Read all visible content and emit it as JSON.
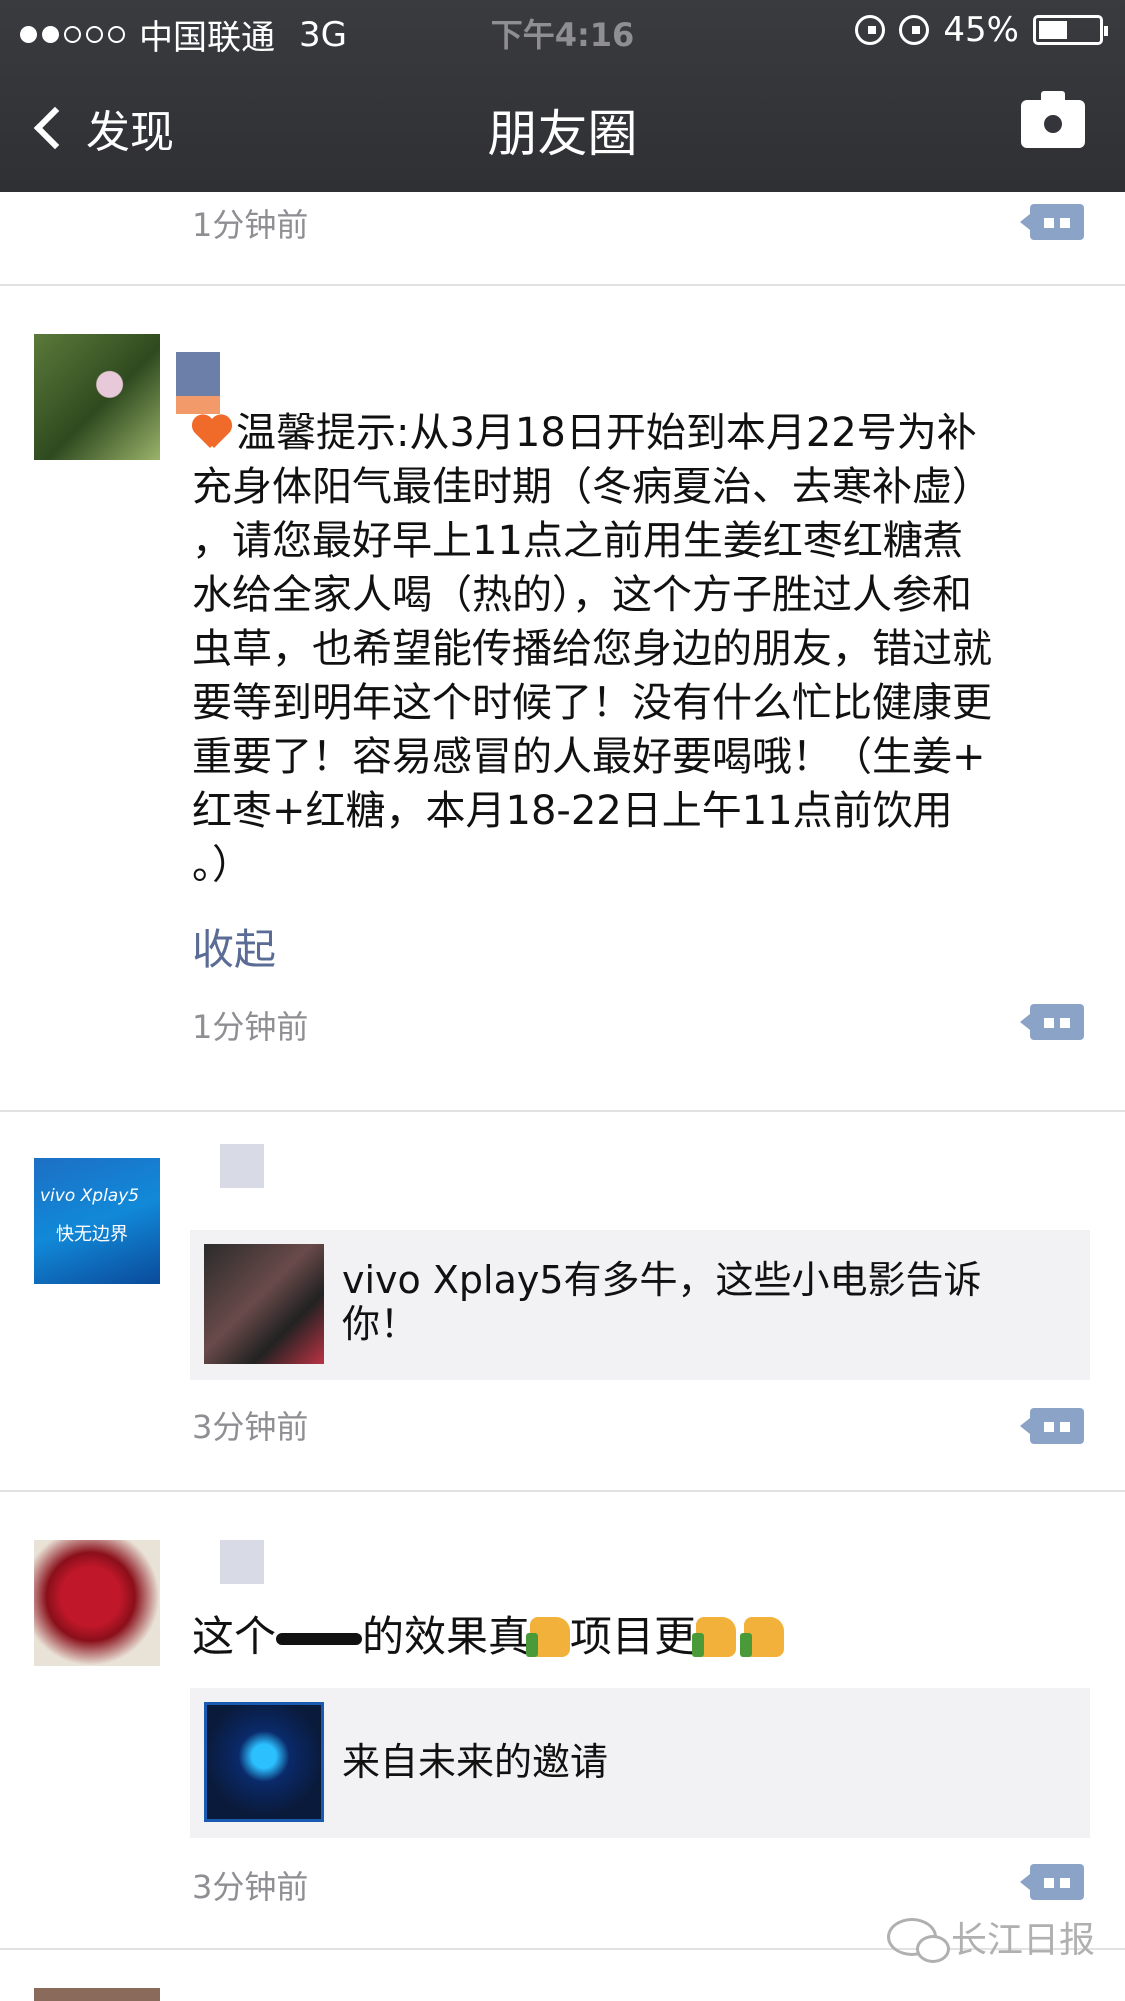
{
  "status_bar": {
    "carrier": "中国联通",
    "network": "3G",
    "time": "下午4:16",
    "battery": "45%",
    "signal_bars_filled": 2,
    "signal_bars_total": 5
  },
  "nav": {
    "back_label": "发现",
    "title": "朋友圈"
  },
  "posts": [
    {
      "time": "1分钟前"
    },
    {
      "text_lines": [
        "温馨提示:从3月18日开始到本月22号为补",
        "充身体阳气最佳时期（冬病夏治、去寒补虚）",
        "，请您最好早上11点之前用生姜红枣红糖煮",
        "水给全家人喝（热的），这个方子胜过人参和",
        "虫草，也希望能传播给您身边的朋友，错过就",
        "要等到明年这个时候了！没有什么忙比健康更",
        "重要了！容易感冒的人最好要喝哦！（生姜+",
        "红枣+红糖，本月18-22日上午11点前饮用",
        "。）"
      ],
      "collapse_label": "收起",
      "time": "1分钟前"
    },
    {
      "avatar_caption_top": "vivo Xplay5",
      "avatar_caption_bottom": "快无边界",
      "link_title_lines": [
        "vivo Xplay5有多牛，这些小电影告诉",
        "你！"
      ],
      "time": "3分钟前"
    },
    {
      "text_before": "这个",
      "text_middle": "的效果真",
      "text_after": "项目更",
      "link_title": "来自未来的邀请",
      "time": "3分钟前"
    }
  ],
  "watermark": "长江日报",
  "colors": {
    "link_blue": "#5a6b96",
    "comment_button": "#8aa3c6",
    "nav_bg": "#333438"
  }
}
